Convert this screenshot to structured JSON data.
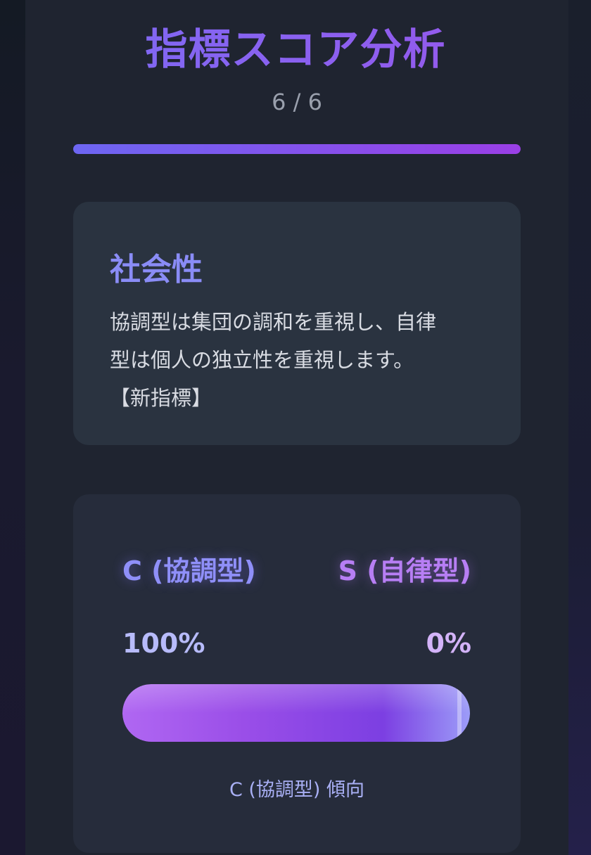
{
  "header": {
    "title": "指標スコア分析",
    "progress_text": "6 / 6",
    "progress_fraction": 1.0
  },
  "metric": {
    "name": "社会性",
    "description_line1": "協調型は集団の調和を重視し、自律",
    "description_line2": "型は個人の独立性を重視します。",
    "description_line3": "【新指標】"
  },
  "score": {
    "left_label": "C (協調型)",
    "right_label": "S (自律型)",
    "left_percent": "100%",
    "right_percent": "0%",
    "left_fraction": 1.0,
    "tendency": "C (協調型) 傾向"
  },
  "colors": {
    "accent_blue": "#8a8cf6",
    "accent_purple": "#9a4ee8",
    "background": "#1f2430"
  }
}
